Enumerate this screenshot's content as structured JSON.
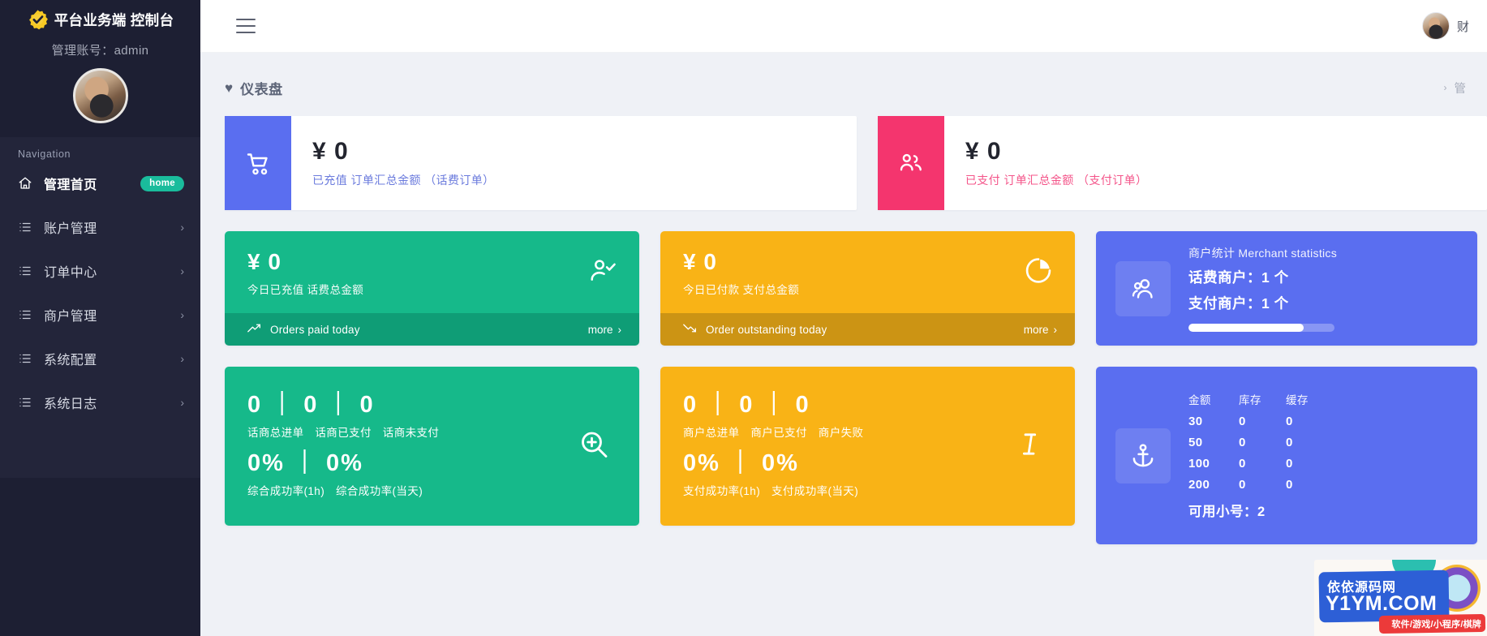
{
  "sidebar": {
    "brand_title": "平台业务端 控制台",
    "brand_logo_icon": "shield-check-gear-icon",
    "account_label": "管理账号：admin",
    "avatar_name": "user-avatar",
    "nav_header": "Navigation",
    "items": [
      {
        "label": "管理首页",
        "icon": "home-icon",
        "badge": "home",
        "active": true
      },
      {
        "label": "账户管理",
        "icon": "list-icon",
        "arrow": "›",
        "active": false
      },
      {
        "label": "订单中心",
        "icon": "list-icon",
        "arrow": "›",
        "active": false
      },
      {
        "label": "商户管理",
        "icon": "list-icon",
        "arrow": "›",
        "active": false
      },
      {
        "label": "系统配置",
        "icon": "list-icon",
        "arrow": "›",
        "active": false
      },
      {
        "label": "系统日志",
        "icon": "list-icon",
        "arrow": "›",
        "active": false
      }
    ]
  },
  "topbar": {
    "menu_toggle_icon": "hamburger-icon",
    "user_name": "财"
  },
  "page": {
    "title": "仪表盘",
    "title_icon": "heart-icon",
    "breadcrumb_sep": "›",
    "breadcrumb_last": "管"
  },
  "row1": [
    {
      "icon": "shopping-cart-icon",
      "value": "¥ 0",
      "label": "已充值 订单汇总金额 （话费订单）",
      "color": "#5a6ef0"
    },
    {
      "icon": "users-icon",
      "value": "¥ 0",
      "label": "已支付 订单汇总金额 （支付订单）",
      "color": "#f4356e"
    }
  ],
  "row2": [
    {
      "value": "¥ 0",
      "sub": "今日已充值 话费总金额",
      "icon": "user-check-icon",
      "foot_icon": "trend-up-icon",
      "foot_label": "Orders paid today",
      "more_label": "more",
      "more_arrow": "›",
      "color": "#16b98a"
    },
    {
      "value": "¥ 0",
      "sub": "今日已付款 支付总金额",
      "icon": "pie-chart-icon",
      "foot_icon": "trend-down-icon",
      "foot_label": "Order outstanding today",
      "more_label": "more",
      "more_arrow": "›",
      "color": "#f9b316"
    }
  ],
  "merchant_panel": {
    "icon": "people-group-icon",
    "caption": "商户统计 Merchant statistics",
    "line1": "话费商户：1 个",
    "line2": "支付商户：1 个",
    "progress_percent": 79
  },
  "row3": [
    {
      "value_top": "0 ｜ 0 ｜ 0",
      "label_top": "话商总进单　话商已支付　话商未支付",
      "value_bottom": "0% ｜ 0%",
      "label_bottom": "综合成功率(1h)　综合成功率(当天)",
      "icon": "zoom-in-icon",
      "color": "#16b98a"
    },
    {
      "value_top": "0 ｜ 0 ｜ 0",
      "label_top": "商户总进单　商户已支付　商户失败",
      "value_bottom": "0% ｜ 0%",
      "label_bottom": "支付成功率(1h)　支付成功率(当天)",
      "icon": "text-cursor-icon",
      "color": "#f9b316"
    }
  ],
  "stock_panel": {
    "icon": "anchor-icon",
    "columns": [
      "金额",
      "库存",
      "缓存"
    ],
    "rows": [
      [
        "30",
        "0",
        "0"
      ],
      [
        "50",
        "0",
        "0"
      ],
      [
        "100",
        "0",
        "0"
      ],
      [
        "200",
        "0",
        "0"
      ]
    ],
    "total_label": "可用小号：2"
  },
  "watermark": {
    "line1": "依依源码网",
    "line2": "Y1YM.COM",
    "line3": "软件/游戏/小程序/棋牌"
  }
}
